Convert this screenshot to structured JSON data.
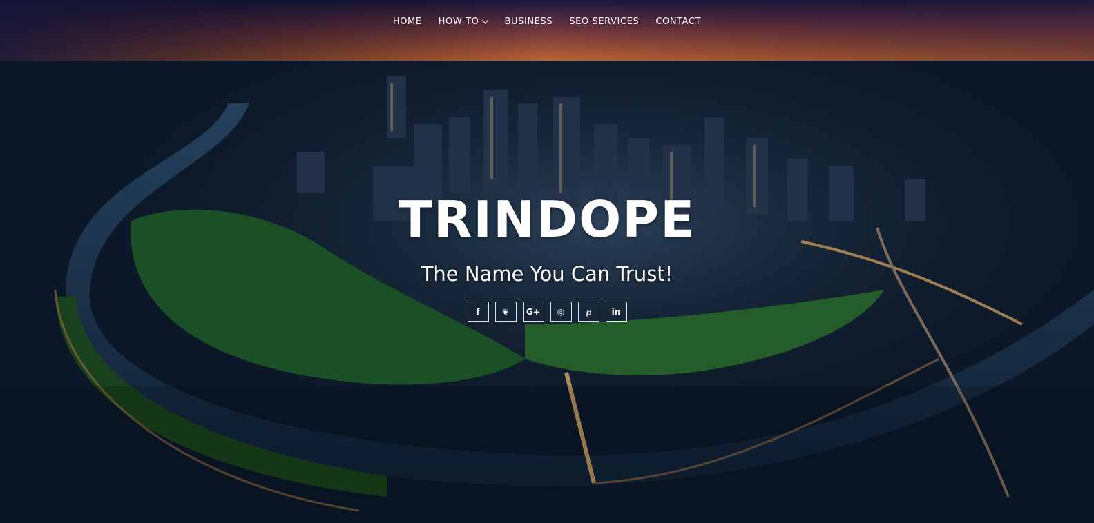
{
  "nav": {
    "items": [
      {
        "label": "HOME"
      },
      {
        "label": "HOW TO"
      },
      {
        "label": "BUSINESS"
      },
      {
        "label": "SEO SERVICES"
      },
      {
        "label": "CONTACT"
      }
    ]
  },
  "hero": {
    "title": "TRINDOPE",
    "tagline": "The Name You Can Trust!"
  },
  "social": [
    {
      "icon": "facebook-icon",
      "glyph": "f"
    },
    {
      "icon": "twitter-icon",
      "glyph": "❦"
    },
    {
      "icon": "google-plus-icon",
      "glyph": "G+"
    },
    {
      "icon": "instagram-icon",
      "glyph": "◎"
    },
    {
      "icon": "pinterest-icon",
      "glyph": "℘"
    },
    {
      "icon": "linkedin-icon",
      "glyph": "in"
    }
  ],
  "colors": {
    "sky_top": "#1a1f4a",
    "sunset": "#c8643a",
    "river": "#1e3a5c",
    "park": "#2f7a3a"
  }
}
